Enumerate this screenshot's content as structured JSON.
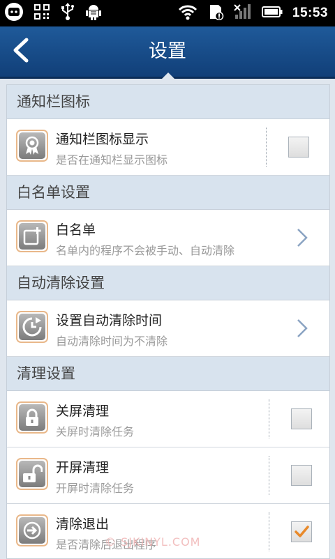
{
  "status_bar": {
    "time": "15:53",
    "icons": [
      "app-notification-icon",
      "qr-code-icon",
      "usb-icon",
      "android-debug-icon",
      "wifi-icon",
      "sd-card-icon",
      "signal-icon",
      "battery-icon"
    ]
  },
  "header": {
    "title": "设置"
  },
  "sections": [
    {
      "header": "通知栏图标",
      "rows": [
        {
          "title": "通知栏图标显示",
          "subtitle": "是否在通知栏显示图标",
          "control": "checkbox",
          "checked": false,
          "icon": "ribbon-badge-icon"
        }
      ]
    },
    {
      "header": "白名单设置",
      "rows": [
        {
          "title": "白名单",
          "subtitle": "名单内的程序不会被手动、自动清除",
          "control": "chevron",
          "icon": "add-note-icon"
        }
      ]
    },
    {
      "header": "自动清除设置",
      "rows": [
        {
          "title": "设置自动清除时间",
          "subtitle": "自动清除时间为不清除",
          "control": "chevron",
          "icon": "clock-icon"
        }
      ]
    },
    {
      "header": "清理设置",
      "rows": [
        {
          "title": "关屏清理",
          "subtitle": "关屏时清除任务",
          "control": "checkbox",
          "checked": false,
          "icon": "lock-icon"
        },
        {
          "title": "开屏清理",
          "subtitle": "开屏时清除任务",
          "control": "checkbox",
          "checked": false,
          "icon": "unlock-icon"
        },
        {
          "title": "清除退出",
          "subtitle": "是否清除后退出程序",
          "control": "checkbox",
          "checked": true,
          "icon": "exit-icon"
        }
      ]
    }
  ],
  "watermark": "© SJKINYL.COM",
  "colors": {
    "header_bg": "#164c8a",
    "section_bg": "#d8e3ee",
    "icon_border": "#e9b88a",
    "check": "#e8892a"
  }
}
